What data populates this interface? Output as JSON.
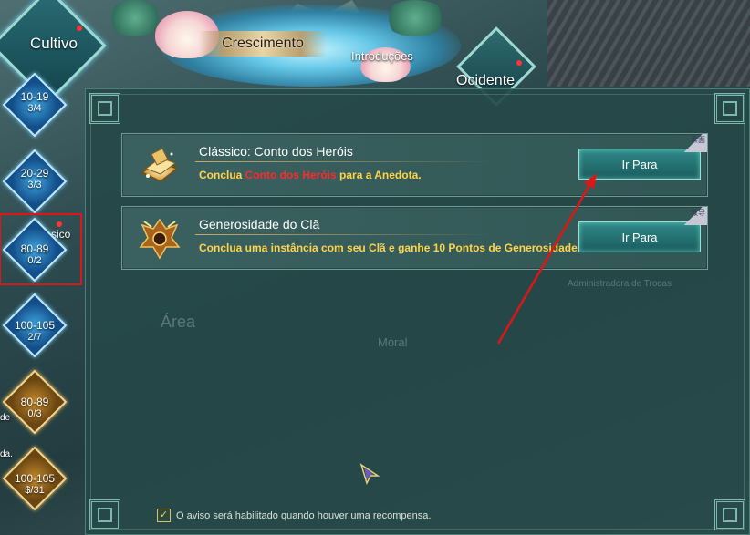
{
  "tabs": {
    "cultivo": "Cultivo",
    "crescimento": "Crescimento",
    "introducoes": "Introduções",
    "ocidente": "Ocidente"
  },
  "levels": [
    {
      "range": "10-19",
      "count": "3/4",
      "color": "blue"
    },
    {
      "range": "20-29",
      "count": "3/3",
      "color": "blue"
    },
    {
      "range": "80-89",
      "count": "0/2",
      "color": "blue",
      "selected": true
    },
    {
      "range": "100-105",
      "count": "2/7",
      "color": "blue"
    },
    {
      "range": "80-89",
      "count": "0/3",
      "color": "gold"
    },
    {
      "range": "100-105",
      "count": "$/31",
      "color": "gold"
    }
  ],
  "side_fragments": {
    "behind_selected": "sico",
    "left_a": "de",
    "left_b": "da."
  },
  "tasks": [
    {
      "title": "Clássico: Conto dos Heróis",
      "desc_before": "Conclua ",
      "desc_highlight": "Conto dos Heróis",
      "desc_after": " para a Anedota.",
      "button": "Ir Para",
      "tag": "乘面",
      "icon": "book-icon"
    },
    {
      "title": "Generosidade do Clã",
      "desc": "Conclua uma instância com seu Clã e ganhe 10 Pontos de Generosidade.",
      "button": "Ir Para",
      "tag": "教导",
      "icon": "clan-crest-icon"
    }
  ],
  "background_labels": {
    "area": "Área",
    "moral": "Moral",
    "admin": "Administradora de Trocas"
  },
  "footer": {
    "checkbox_checked": true,
    "text": "O aviso será habilitado quando houver uma recompensa."
  },
  "colors": {
    "highlight": "#ff2a2a",
    "desc": "#ffd34a",
    "annotation": "#e01515"
  }
}
